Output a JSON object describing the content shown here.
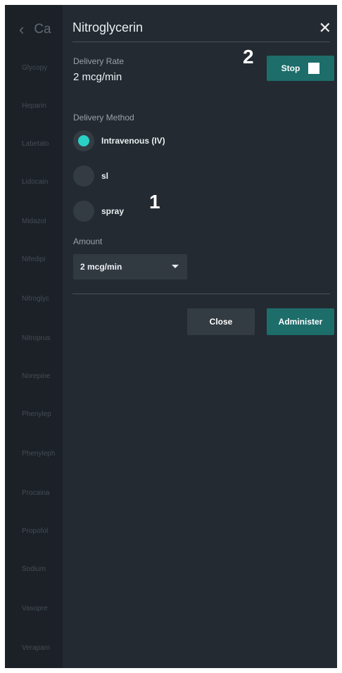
{
  "background_list": {
    "header_text": "Ca",
    "items": [
      "Glycopy",
      "Heparin",
      "Labetalo",
      "Lidocain",
      "Midazol",
      "Nifedipi",
      "Nitroglyc",
      "Nitroprus",
      "Norepine",
      "Phenylep",
      "Phenyleph",
      "Procaina",
      "Propofol",
      "Sodium",
      "Vasopre",
      "Verapam"
    ]
  },
  "panel": {
    "title": "Nitroglycerin",
    "close_icon": "✕",
    "delivery_rate_label": "Delivery Rate",
    "delivery_rate_value": "2 mcg/min",
    "stop_label": "Stop",
    "delivery_method_label": "Delivery Method",
    "methods": [
      {
        "label": "Intravenous (IV)",
        "selected": true
      },
      {
        "label": "sl",
        "selected": false
      },
      {
        "label": "spray",
        "selected": false
      }
    ],
    "amount_label": "Amount",
    "amount_value": "2 mcg/min",
    "close_button": "Close",
    "administer_button": "Administer"
  },
  "annotations": {
    "one": "1",
    "two": "2"
  },
  "colors": {
    "accent": "#2bd0c6",
    "button_teal": "#1d6d6a",
    "panel_bg": "#232a31"
  }
}
